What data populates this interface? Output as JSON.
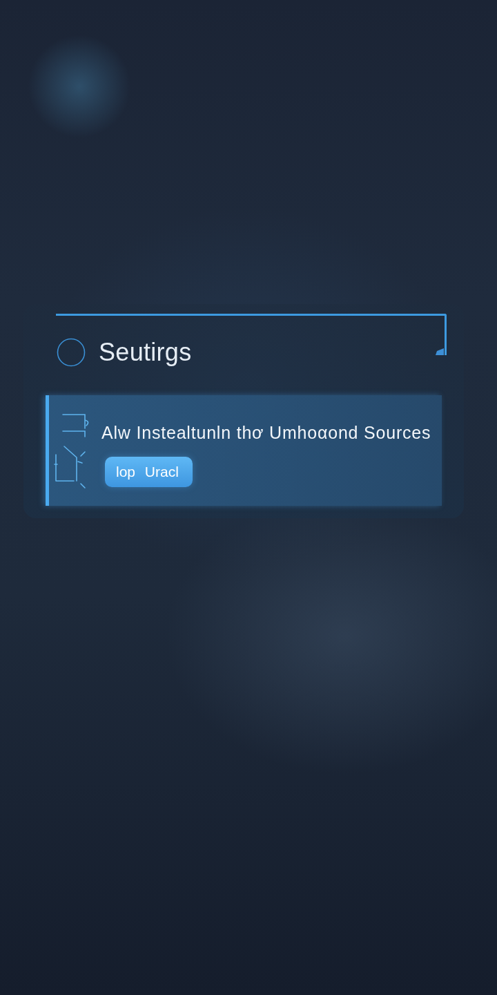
{
  "header": {
    "title": "Seutirgs"
  },
  "settings": [
    {
      "title": "Alw Instealtunln thơ Umhoαond Sources",
      "button": "lop Uracl",
      "selected": true
    }
  ]
}
